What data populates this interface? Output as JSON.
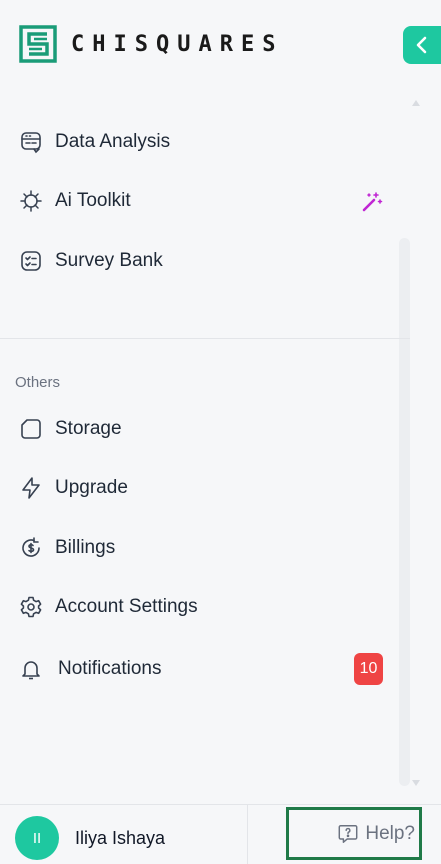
{
  "brand": {
    "name": "CHISQUARES",
    "accent": "#1ec8a0"
  },
  "nav": {
    "items": [
      {
        "label": "Data Analysis",
        "icon": "data-analysis-icon"
      },
      {
        "label": "Ai Toolkit",
        "icon": "virus-bug-icon",
        "extra_icon": "magic-wand-icon"
      },
      {
        "label": "Survey Bank",
        "icon": "checklist-icon"
      }
    ]
  },
  "others": {
    "section_label": "Others",
    "items": [
      {
        "label": "Storage",
        "icon": "folder-icon"
      },
      {
        "label": "Upgrade",
        "icon": "lightning-icon"
      },
      {
        "label": "Billings",
        "icon": "dollar-refresh-icon"
      },
      {
        "label": "Account Settings",
        "icon": "gear-icon"
      },
      {
        "label": "Notifications",
        "icon": "bell-icon",
        "badge": "10"
      }
    ]
  },
  "footer": {
    "avatar_initials": "II",
    "user_name": "Iliya Ishaya",
    "help_label": "Help?"
  }
}
